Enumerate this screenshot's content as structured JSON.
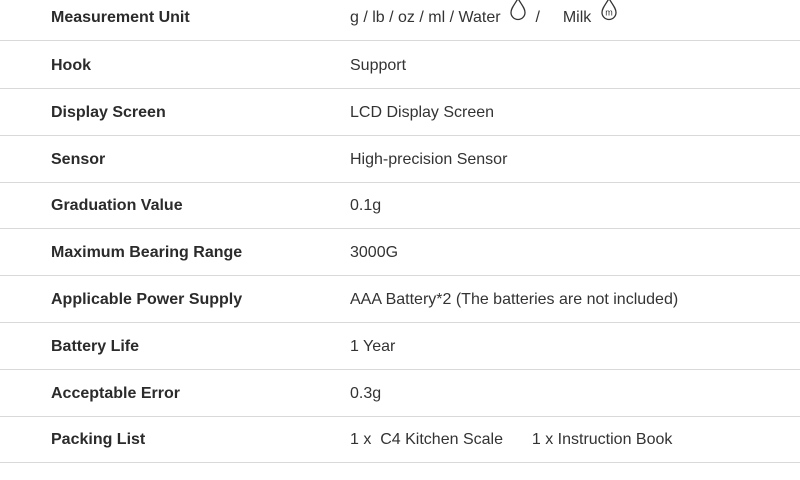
{
  "specs": [
    {
      "label": "Measurement Unit",
      "value_parts": {
        "units": "g / lb / oz / ml /",
        "water": "Water",
        "separator": "/",
        "milk": "Milk",
        "water_icon": "water-drop-icon",
        "milk_icon": "milk-drop-icon",
        "milk_icon_letter": "m"
      }
    },
    {
      "label": "Hook",
      "value": "Support"
    },
    {
      "label": "Display Screen",
      "value": "LCD Display Screen"
    },
    {
      "label": "Sensor",
      "value": "High-precision Sensor"
    },
    {
      "label": "Graduation Value",
      "value": "0.1g"
    },
    {
      "label": "Maximum Bearing Range",
      "value": "3000G"
    },
    {
      "label": "Applicable Power Supply",
      "value": "AAA Battery*2 (The batteries are not included)"
    },
    {
      "label": "Battery Life",
      "value": "1 Year"
    },
    {
      "label": "Acceptable Error",
      "value": "0.3g"
    },
    {
      "label": "Packing List",
      "value_parts": {
        "item1": "1 x  C4 Kitchen Scale",
        "item2": "1 x Instruction Book"
      }
    }
  ],
  "colors": {
    "text": "#333333",
    "label": "#2b2b2b",
    "divider": "#d9d9d9",
    "background": "#ffffff"
  }
}
